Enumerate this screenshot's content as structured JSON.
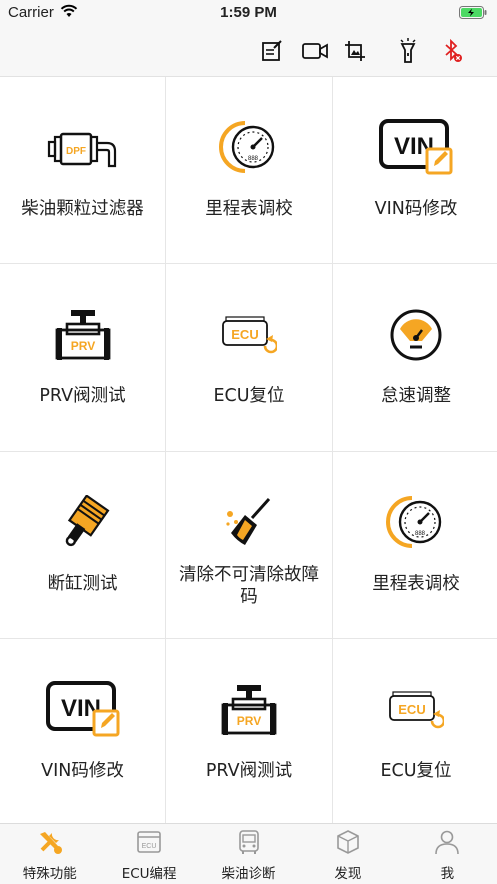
{
  "status_bar": {
    "carrier": "Carrier",
    "time": "1:59 PM"
  },
  "toolbar": {
    "icons": [
      "edit-note-icon",
      "video-camera-icon",
      "crop-image-icon",
      "flashlight-icon",
      "bluetooth-disconnected-icon"
    ],
    "colors": {
      "bluetooth": "#e02020"
    }
  },
  "functions": [
    {
      "label": "柴油颗粒过滤器",
      "icon": "dpf-filter-icon"
    },
    {
      "label": "里程表调校",
      "icon": "odometer-icon"
    },
    {
      "label": "VIN码修改",
      "icon": "vin-edit-icon"
    },
    {
      "label": "PRV阀测试",
      "icon": "prv-valve-icon"
    },
    {
      "label": "ECU复位",
      "icon": "ecu-reset-icon"
    },
    {
      "label": "怠速调整",
      "icon": "idle-speed-icon"
    },
    {
      "label": "断缸测试",
      "icon": "cylinder-cutoff-icon"
    },
    {
      "label": "清除不可清除故障码",
      "icon": "clear-broom-icon"
    },
    {
      "label": "里程表调校",
      "icon": "odometer-icon"
    },
    {
      "label": "VIN码修改",
      "icon": "vin-edit-icon"
    },
    {
      "label": "PRV阀测试",
      "icon": "prv-valve-icon"
    },
    {
      "label": "ECU复位",
      "icon": "ecu-reset-icon"
    }
  ],
  "tab_bar": {
    "tabs": [
      {
        "label": "特殊功能",
        "icon": "tools-icon",
        "active": true
      },
      {
        "label": "ECU编程",
        "icon": "ecu-chip-icon",
        "active": false
      },
      {
        "label": "柴油诊断",
        "icon": "bus-icon",
        "active": false
      },
      {
        "label": "发现",
        "icon": "cube-icon",
        "active": false
      },
      {
        "label": "我",
        "icon": "user-icon",
        "active": false
      }
    ],
    "colors": {
      "active": "#f5a623",
      "inactive": "#999999"
    }
  },
  "colors": {
    "accent": "#f5a623",
    "icon_dark": "#1a1a1a",
    "grid_line": "#e6e6e6"
  }
}
